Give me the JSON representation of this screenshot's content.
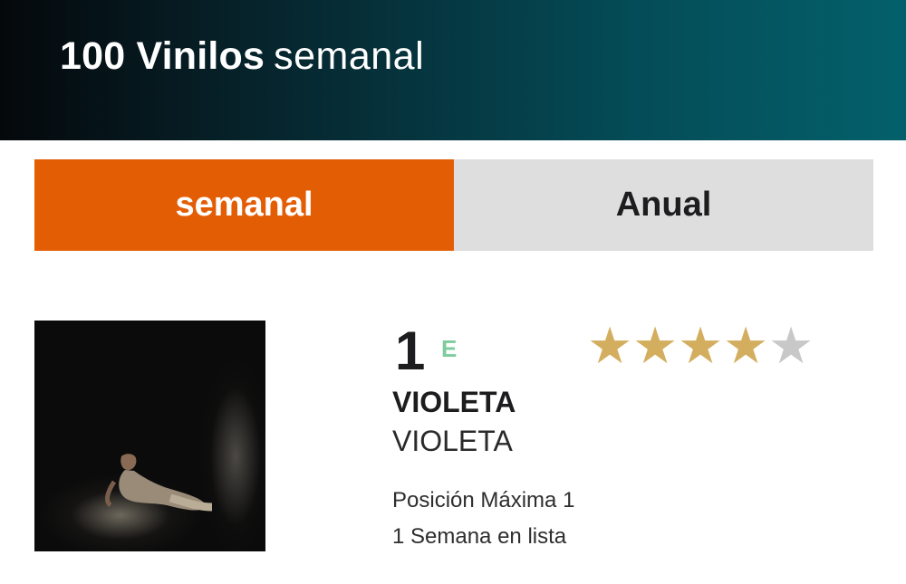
{
  "header": {
    "title_bold": "100 Vinilos",
    "title_light": "semanal"
  },
  "tabs": [
    {
      "label": "semanal",
      "active": true
    },
    {
      "label": "Anual",
      "active": false
    }
  ],
  "entry": {
    "rank": "1",
    "badge": "E",
    "artist": "VIOLETA",
    "album": "VIOLETA",
    "peak_position": "Posición Máxima 1",
    "weeks_on_chart": "1 Semana en lista",
    "rating": 4,
    "rating_max": 5,
    "cover_icon": "album-cover-image"
  },
  "colors": {
    "accent": "#e35d05",
    "star_on": "#d4ae5f",
    "star_off": "#c8c8c8",
    "badge": "#7ecb9c"
  }
}
